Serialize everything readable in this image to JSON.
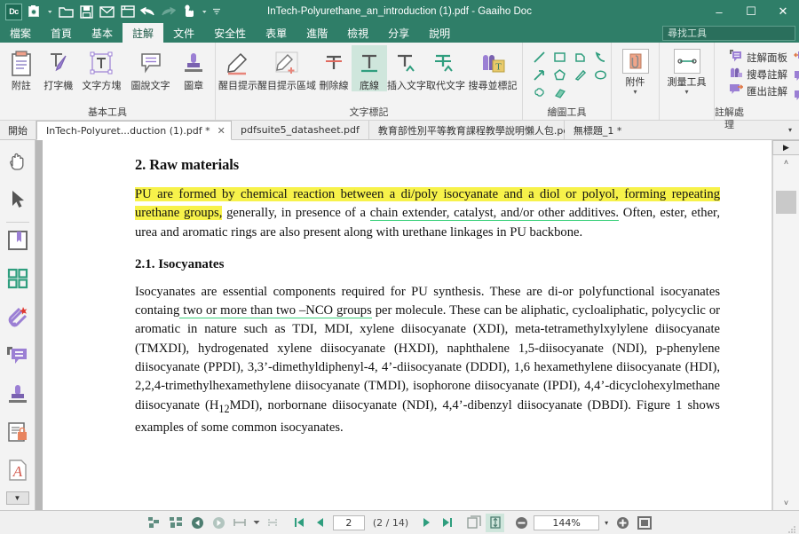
{
  "window": {
    "title": "InTech-Polyurethane_an_introduction (1).pdf - Gaaiho Doc",
    "minimize": "–",
    "maximize": "☐",
    "close": "✕"
  },
  "quick_access": {
    "logo": "Dc",
    "items": [
      {
        "name": "new-document-icon",
        "glyph": "▣"
      },
      {
        "name": "open-folder-icon",
        "glyph": "▱"
      },
      {
        "name": "save-icon",
        "glyph": "▤"
      },
      {
        "name": "email-icon",
        "glyph": "✉"
      },
      {
        "name": "print-icon",
        "glyph": "⎙"
      },
      {
        "name": "undo-icon",
        "glyph": "↩"
      },
      {
        "name": "redo-icon",
        "glyph": "↪"
      },
      {
        "name": "select-tool-icon",
        "glyph": "☞"
      },
      {
        "name": "customize-qat-icon",
        "glyph": "≡"
      }
    ]
  },
  "menu": {
    "items": [
      {
        "label": "檔案",
        "active": false
      },
      {
        "label": "首頁",
        "active": false
      },
      {
        "label": "基本",
        "active": false
      },
      {
        "label": "註解",
        "active": true
      },
      {
        "label": "文件",
        "active": false
      },
      {
        "label": "安全性",
        "active": false
      },
      {
        "label": "表單",
        "active": false
      },
      {
        "label": "進階",
        "active": false
      },
      {
        "label": "檢視",
        "active": false
      },
      {
        "label": "分享",
        "active": false
      },
      {
        "label": "說明",
        "active": false
      }
    ]
  },
  "search": {
    "placeholder": "尋找工具",
    "value": "",
    "icon": "search-icon",
    "collapse": "˄"
  },
  "ribbon": {
    "groups": [
      {
        "name": "basic-tools",
        "label": "基本工具",
        "buttons": [
          {
            "label": "附註",
            "icon": "sticky-note-icon",
            "selected": false
          },
          {
            "label": "打字機",
            "icon": "typewriter-icon",
            "selected": false
          },
          {
            "label": "文字方塊",
            "icon": "text-box-icon",
            "selected": false
          },
          {
            "label": "圖說文字",
            "icon": "callout-icon",
            "selected": false
          },
          {
            "label": "圖章",
            "icon": "stamp-icon",
            "selected": false
          }
        ]
      },
      {
        "name": "text-markup",
        "label": "文字標記",
        "buttons": [
          {
            "label": "醒目提示",
            "icon": "highlight-icon",
            "selected": false
          },
          {
            "label": "醒目提示區域",
            "icon": "highlight-area-icon",
            "selected": false
          },
          {
            "label": "刪除線",
            "icon": "strikethrough-icon",
            "selected": false
          },
          {
            "label": "底線",
            "icon": "underline-icon",
            "selected": true
          },
          {
            "label": "插入文字",
            "icon": "insert-text-icon",
            "selected": false
          },
          {
            "label": "取代文字",
            "icon": "replace-text-icon",
            "selected": false
          },
          {
            "label": "搜尋並標記",
            "icon": "search-and-markup-icon",
            "selected": false
          }
        ]
      },
      {
        "name": "drawing-tools",
        "label": "繪圖工具",
        "shapes": [
          {
            "icon": "line-icon"
          },
          {
            "icon": "rectangle-icon"
          },
          {
            "icon": "polygon-cloud-icon"
          },
          {
            "icon": "arrow-up-left-icon"
          },
          {
            "icon": "arrow-icon"
          },
          {
            "icon": "pentagon-icon"
          },
          {
            "icon": "pencil-icon"
          },
          {
            "icon": "ellipse-icon"
          },
          {
            "icon": "cloud-icon"
          },
          {
            "icon": "eraser-icon"
          }
        ]
      },
      {
        "name": "attachment-measure",
        "buttons": [
          {
            "label": "附件",
            "icon": "attachment-file-icon",
            "dropdown": "▾"
          },
          {
            "label": "測量工具",
            "icon": "measure-icon",
            "dropdown": "▾"
          }
        ]
      },
      {
        "name": "comment-processing",
        "label": "註解處理",
        "rows": [
          {
            "label": "註解面板",
            "icon": "comment-panel-icon",
            "side_icon": "import-comment-icon"
          },
          {
            "label": "搜尋註解",
            "icon": "search-comment-icon",
            "side_icon": "send-comment-icon"
          },
          {
            "label": "匯出註解",
            "icon": "export-comment-icon",
            "side_icon": "comment-status-icon"
          }
        ]
      }
    ]
  },
  "doc_tabs": {
    "home_label": "開始",
    "items": [
      {
        "label": "InTech-Polyuret...duction (1).pdf *",
        "active": true,
        "closable": true
      },
      {
        "label": "pdfsuite5_datasheet.pdf",
        "active": false,
        "closable": false
      },
      {
        "label": "教育部性別平等教育課程教學說明懶人包.pdf",
        "active": false,
        "closable": false
      },
      {
        "label": "無標題_1 *",
        "active": false,
        "closable": false
      }
    ],
    "overflow": "▾"
  },
  "sidebar": {
    "items": [
      {
        "name": "hand-tool-icon",
        "label": "hand-tool"
      },
      {
        "name": "select-arrow-icon",
        "label": "select-arrow"
      },
      {
        "name": "bookmark-panel-icon",
        "label": "bookmarks"
      },
      {
        "name": "thumbnails-panel-icon",
        "label": "thumbnails"
      },
      {
        "name": "attachment-panel-icon",
        "label": "attachments"
      },
      {
        "name": "comment-panel-icon",
        "label": "comments"
      },
      {
        "name": "stamp-panel-icon",
        "label": "stamps"
      },
      {
        "name": "security-panel-icon",
        "label": "security"
      },
      {
        "name": "font-panel-icon",
        "label": "fonts"
      }
    ],
    "more": "▼"
  },
  "document": {
    "heading_1": "2. Raw materials",
    "para_1": {
      "hl_1": "PU are formed by chemical reaction between a di/poly isocyanate and a diol or polyol, forming repeating urethane groups,",
      "mid_1": " generally, in presence of a ",
      "ul_1": "chain extender, catalyst, and/or other additives.",
      "rest_1": " Often, ester, ether, urea and aromatic rings are also present along with urethane linkages in PU backbone."
    },
    "heading_2": "2.1. Isocyanates",
    "para_2": {
      "start": "Isocyanates are essential components required for PU synthesis. These are di-or polyfunctional isocyanates containg",
      "ul_2": " two or more than two –NCO groups",
      "rest_2": " per molecule. These can be aliphatic, cycloaliphatic, polycyclic or aromatic in nature such as TDI, MDI, xylene diisocyanate (XDI), meta-tetramethylxylylene diisocyanate (TMXDI), hydrogenated xylene diisocyanate (HXDI), naphthalene 1,5-diisocyanate (NDI), p-phenylene diisocyanate (PPDI), 3,3’-dimethyldiphenyl-4, 4’-diisocyanate (DDDI), 1,6 hexamethylene diisocyanate (HDI), 2,2,4-trimethylhexamethylene diisocyanate (TMDI), isophorone diisocyanate (IPDI), 4,4’-dicyclohexylmethane diisocyanate (H"
    },
    "sub_12": "12",
    "para_2_tail": "MDI), norbornane diisocyanate (NDI), 4,4’-dibenzyl diisocyanate (DBDI). Figure 1 shows examples of some common isocyanates."
  },
  "statusbar": {
    "buttons": [
      {
        "name": "pan-page-icon",
        "glyph": "❖"
      },
      {
        "name": "reflow-icon",
        "glyph": "❖"
      },
      {
        "name": "previous-view-icon",
        "glyph": "◀"
      },
      {
        "name": "next-view-icon",
        "glyph": "▶"
      },
      {
        "name": "fit-page-layout-icon",
        "glyph": "≔"
      },
      {
        "name": "split-view-icon",
        "glyph": "÷"
      }
    ],
    "first_page": "⏮",
    "prev_page": "◀",
    "page_value": "2",
    "page_count": "(2 / 14)",
    "next_page": "▶",
    "last_page": "⏭",
    "single_page_icon": "page-layout-icon",
    "continuous_icon": "continuous-scroll-icon",
    "zoom_out": "−",
    "zoom_value": "144%",
    "zoom_caret": "▾",
    "zoom_in": "+",
    "fullscreen_icon": "fullscreen-icon"
  },
  "right_rail": {
    "collapse_icon": "▶",
    "scroll_up": "˄",
    "scroll_down": "˅"
  },
  "colors": {
    "ribbon_teal": "#2f7e68",
    "highlight_yellow": "#f7f24a",
    "underline_green": "#3cd07c",
    "accent_purple": "#9b7fd4",
    "accent_teal": "#2f9e7e",
    "selection_bg": "#cfe6dc"
  }
}
